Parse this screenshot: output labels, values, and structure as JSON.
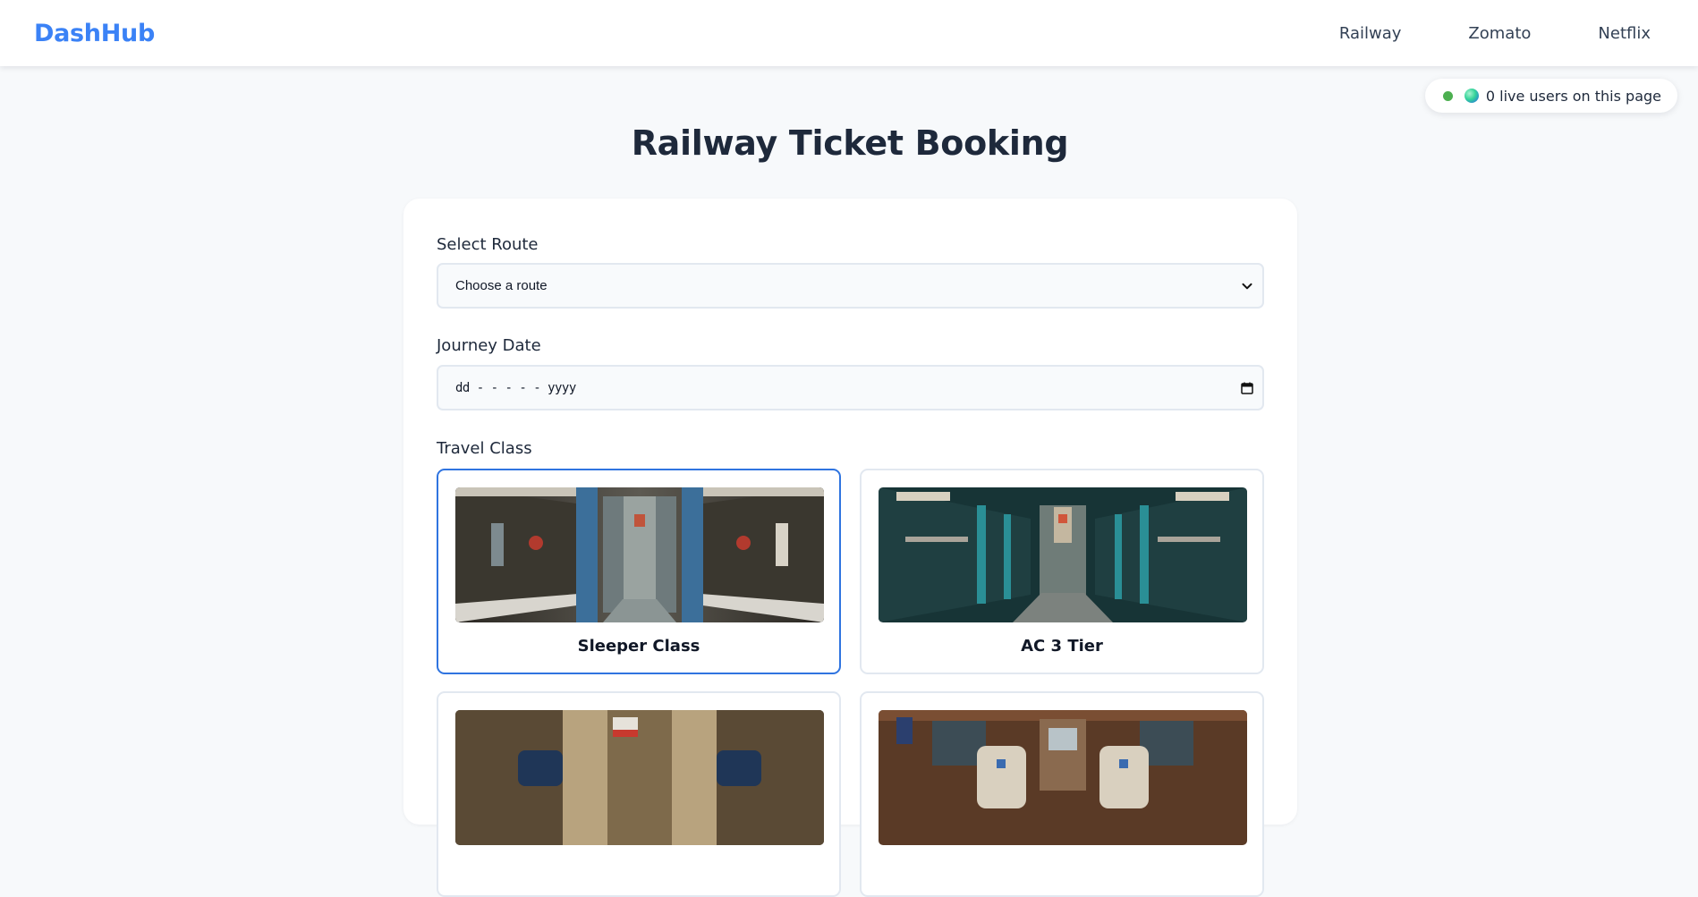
{
  "header": {
    "brand": "DashHub",
    "nav": [
      {
        "label": "Railway"
      },
      {
        "label": "Zomato"
      },
      {
        "label": "Netflix"
      }
    ]
  },
  "live": {
    "text": "0 live users on this page",
    "dot_color": "#4caf50"
  },
  "page": {
    "title": "Railway Ticket Booking"
  },
  "form": {
    "route": {
      "label": "Select Route",
      "selected": "Choose a route"
    },
    "date": {
      "label": "Journey Date",
      "placeholder": "dd - - - - - yyyy"
    },
    "travel_class": {
      "label": "Travel Class",
      "options": [
        {
          "name": "Sleeper Class",
          "selected": true,
          "image": "sleeper-coach-photo"
        },
        {
          "name": "AC 3 Tier",
          "selected": false,
          "image": "ac3-coach-photo"
        },
        {
          "name": "",
          "selected": false,
          "image": "ac2-coach-photo"
        },
        {
          "name": "",
          "selected": false,
          "image": "chair-car-photo"
        }
      ]
    }
  },
  "colors": {
    "brand": "#3b82f6",
    "selected_border": "#2f74e0",
    "page_bg": "#f7f9fb"
  }
}
